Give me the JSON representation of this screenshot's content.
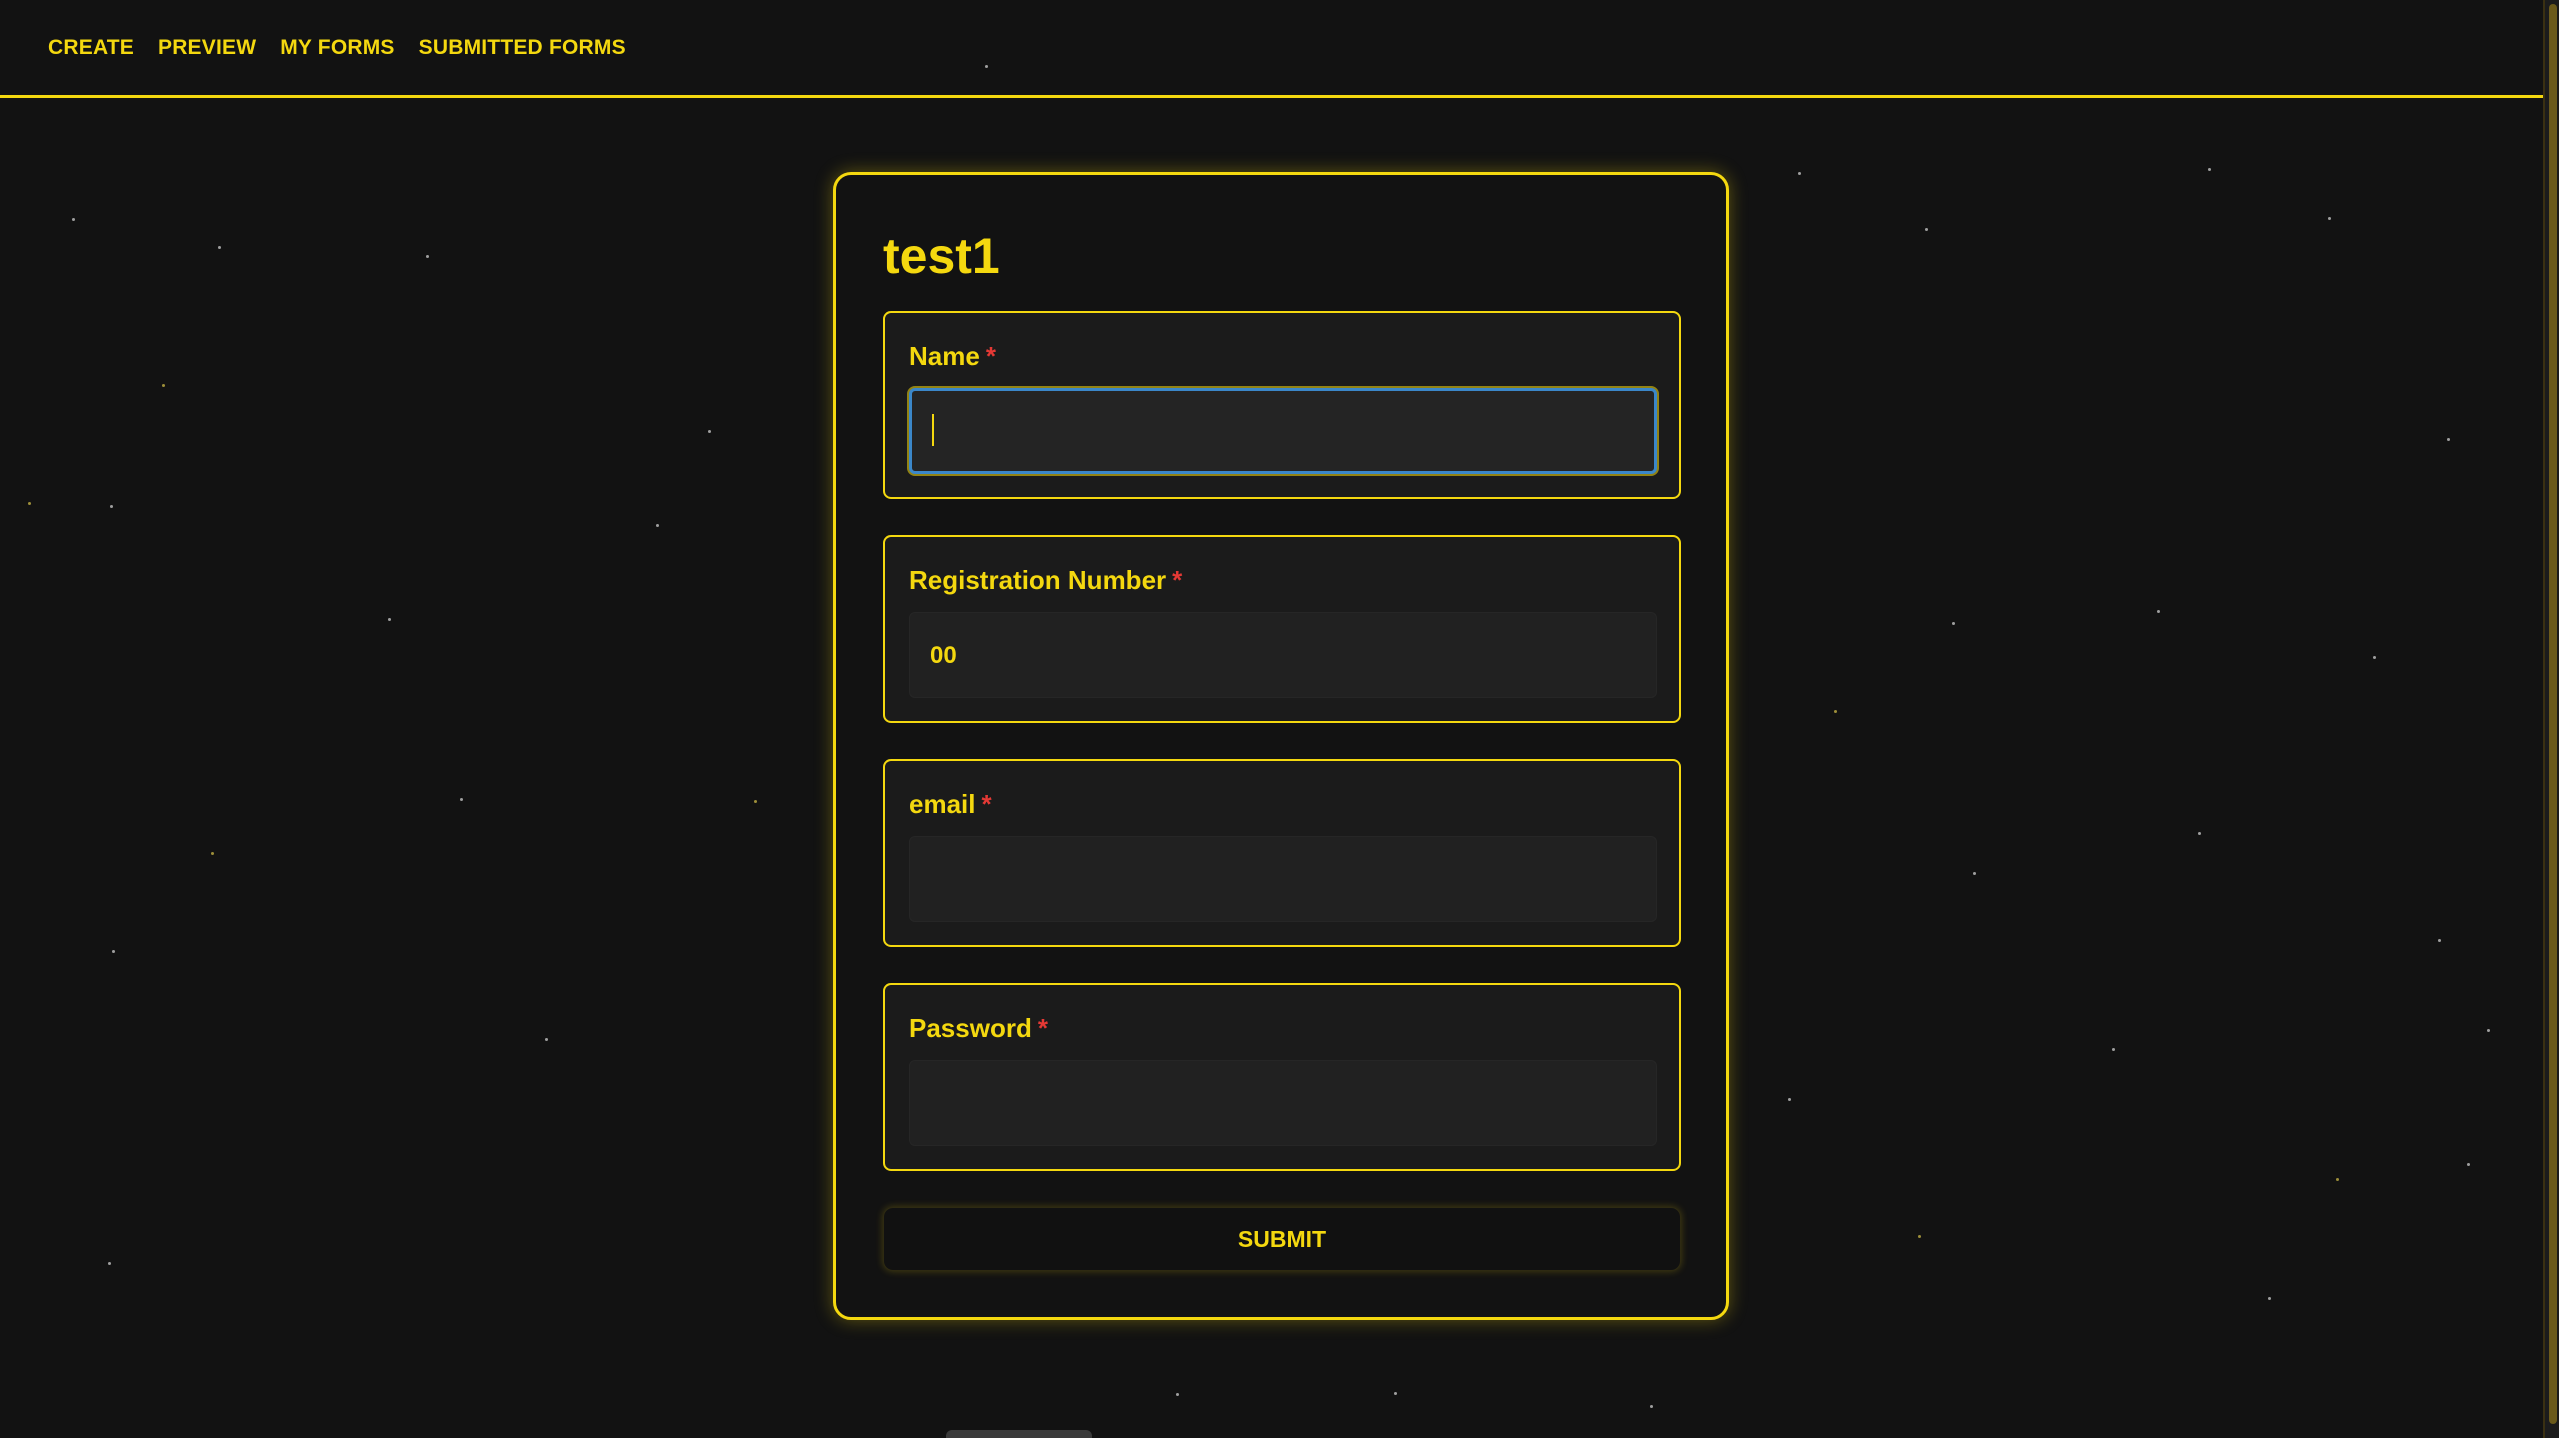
{
  "nav": {
    "items": [
      {
        "label": "CREATE"
      },
      {
        "label": "PREVIEW"
      },
      {
        "label": "MY FORMS"
      },
      {
        "label": "SUBMITTED FORMS"
      }
    ]
  },
  "form": {
    "title": "test1",
    "required_marker": "*",
    "fields": [
      {
        "label": "Name",
        "value": "",
        "focused": true
      },
      {
        "label": "Registration Number",
        "value": "00"
      },
      {
        "label": "email",
        "value": ""
      },
      {
        "label": "Password",
        "value": ""
      }
    ],
    "submit_label": "SUBMIT"
  },
  "colors": {
    "accent": "#f4d80f",
    "background": "#121212",
    "required": "#e53935",
    "focus_ring": "#3b87c9"
  }
}
